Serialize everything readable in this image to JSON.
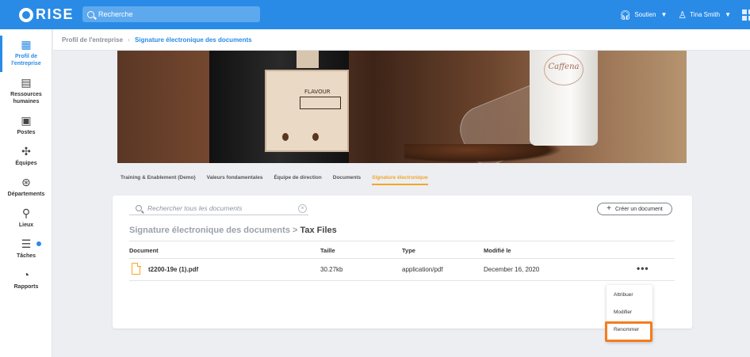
{
  "topbar": {
    "logo_text": "RISE",
    "search_placeholder": "Recherche",
    "support_label": "Soutien",
    "user_name": "Tina Smith"
  },
  "sidebar": {
    "items": [
      {
        "label": "Profil de l'entreprise",
        "icon": "building-icon",
        "active": true
      },
      {
        "label": "Ressources humaines",
        "icon": "contacts-book-icon",
        "active": false
      },
      {
        "label": "Postes",
        "icon": "id-card-icon",
        "active": false
      },
      {
        "label": "Équipes",
        "icon": "network-icon",
        "active": false
      },
      {
        "label": "Départements",
        "icon": "compass-icon",
        "active": false
      },
      {
        "label": "Lieux",
        "icon": "location-pin-icon",
        "active": false
      },
      {
        "label": "Tâches",
        "icon": "tasks-icon",
        "active": false
      },
      {
        "label": "Rapports",
        "icon": "pie-chart-icon",
        "active": false
      }
    ]
  },
  "breadcrumb": {
    "first": "Profil de l'entreprise",
    "current": "Signature électronique des documents"
  },
  "banner": {
    "cup_brand": "Caffena",
    "bag_label": "FLAVOUR"
  },
  "tabs": [
    {
      "label": "Training & Enablement (Demo)",
      "active": false
    },
    {
      "label": "Valeurs fondamentales",
      "active": false
    },
    {
      "label": "Équipe de direction",
      "active": false
    },
    {
      "label": "Documents",
      "active": false
    },
    {
      "label": "Signature électronique",
      "active": true
    }
  ],
  "documents": {
    "search_placeholder": "Rechercher tous les documents",
    "create_label": "Créer un document",
    "path_root": "Signature électronique des documents",
    "path_sep": " > ",
    "path_current": "Tax Files",
    "columns": {
      "document": "Document",
      "size": "Taille",
      "type": "Type",
      "modified": "Modifié le"
    },
    "rows": [
      {
        "name": "t2200-19e (1).pdf",
        "size": "30.27kb",
        "type": "application/pdf",
        "modified": "December 16, 2020"
      }
    ]
  },
  "menu": {
    "items": [
      "Attribuer",
      "Modifier",
      "Renommer"
    ],
    "highlighted": "Renommer"
  },
  "colors": {
    "brand_blue": "#2a8be6",
    "accent_orange": "#f5a623",
    "highlight_orange": "#f57c1f"
  }
}
